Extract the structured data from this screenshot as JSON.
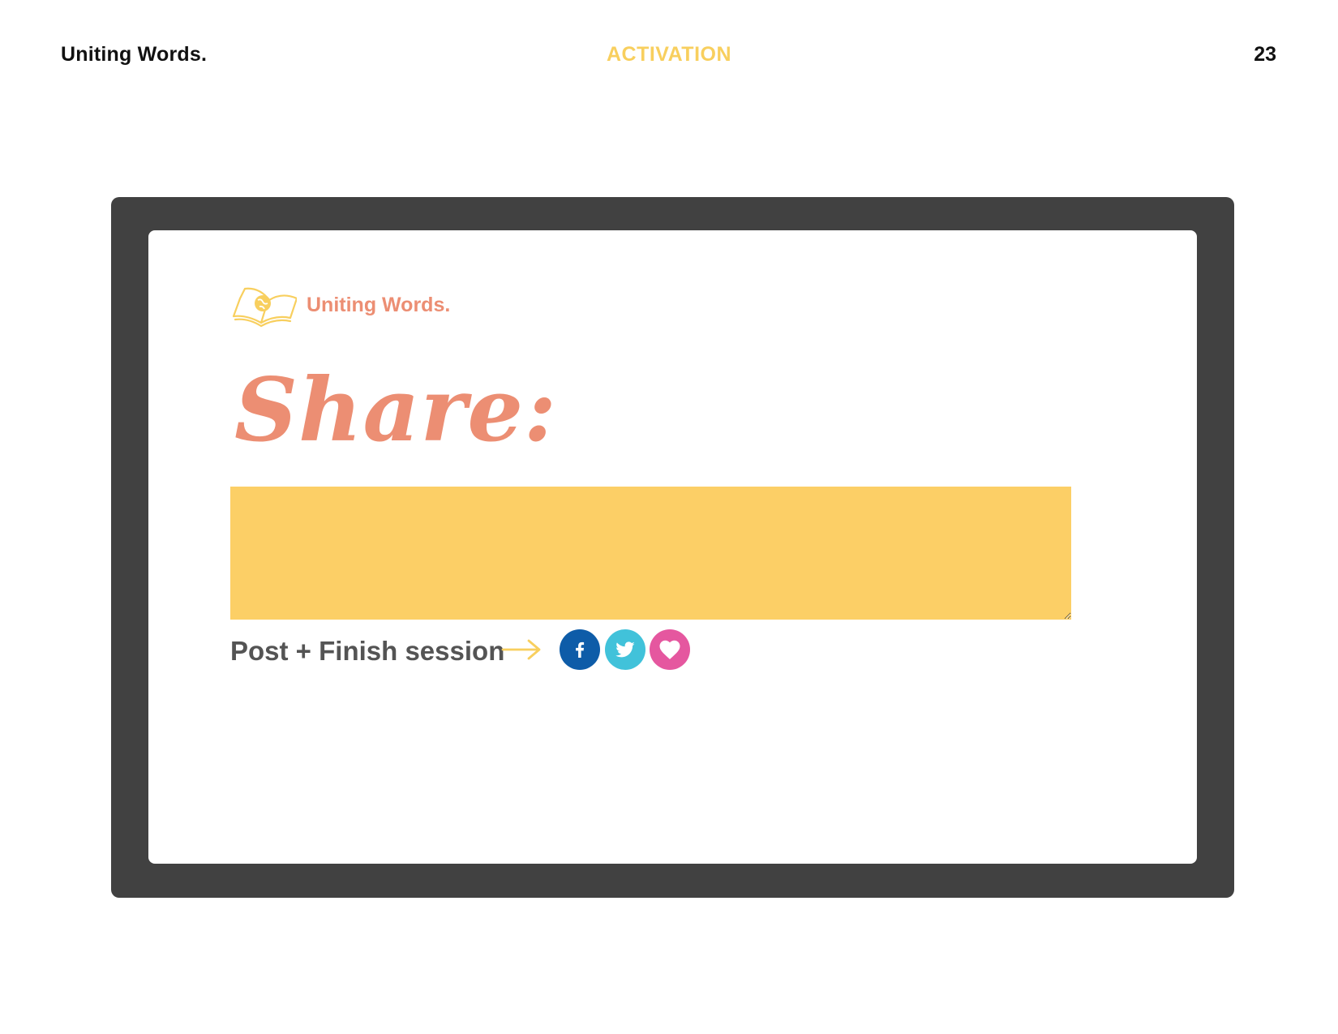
{
  "header": {
    "brand": "Uniting Words.",
    "section": "ACTIVATION",
    "page_number": "23"
  },
  "screen": {
    "logo_text": "Uniting Words.",
    "logo_icon": "open-book-globe-icon",
    "heading": "Share:",
    "share_input_value": "",
    "post_label": "Post + Finish session",
    "arrow_icon": "arrow-right-icon",
    "social_buttons": [
      {
        "icon": "facebook-icon",
        "color": "#0e5ca8"
      },
      {
        "icon": "twitter-icon",
        "color": "#41c2da"
      },
      {
        "icon": "heart-icon",
        "color": "#e5579f"
      }
    ]
  },
  "colors": {
    "accent_yellow": "#fccf66",
    "heading_coral": "#ec8e73",
    "frame_dark": "#414141",
    "text_gray": "#545454"
  }
}
